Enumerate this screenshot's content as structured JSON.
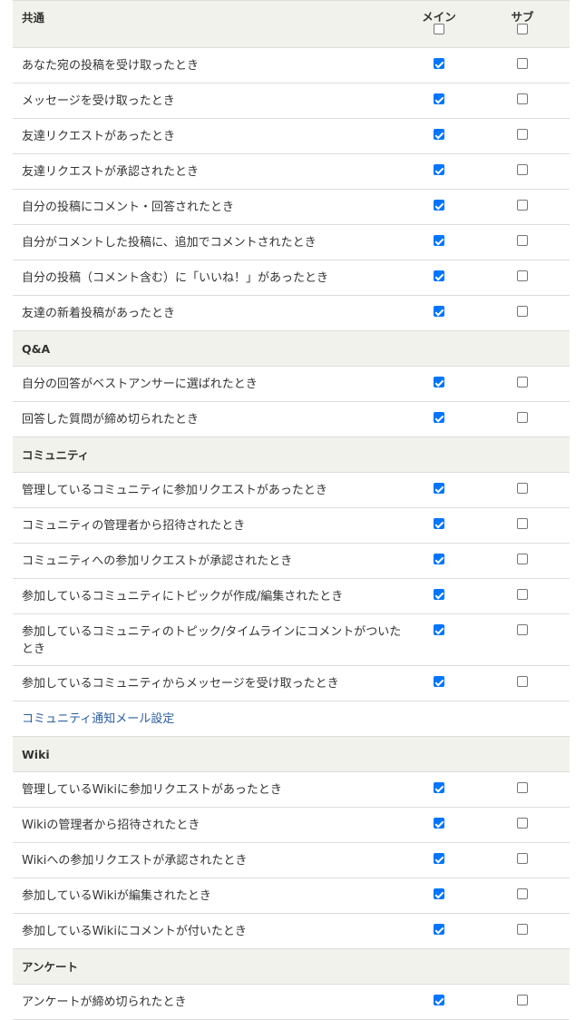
{
  "columns": {
    "main": "メイン",
    "sub": "サブ"
  },
  "header_checks": {
    "main": false,
    "sub": false
  },
  "sections": [
    {
      "title": "共通",
      "items": [
        {
          "label": "あなた宛の投稿を受け取ったとき",
          "main": true,
          "sub": false
        },
        {
          "label": "メッセージを受け取ったとき",
          "main": true,
          "sub": false
        },
        {
          "label": "友達リクエストがあったとき",
          "main": true,
          "sub": false
        },
        {
          "label": "友達リクエストが承認されたとき",
          "main": true,
          "sub": false
        },
        {
          "label": "自分の投稿にコメント・回答されたとき",
          "main": true,
          "sub": false
        },
        {
          "label": "自分がコメントした投稿に、追加でコメントされたとき",
          "main": true,
          "sub": false
        },
        {
          "label": "自分の投稿（コメント含む）に「いいね！」があったとき",
          "main": true,
          "sub": false
        },
        {
          "label": "友達の新着投稿があったとき",
          "main": true,
          "sub": false
        }
      ]
    },
    {
      "title": "Q&A",
      "items": [
        {
          "label": "自分の回答がベストアンサーに選ばれたとき",
          "main": true,
          "sub": false
        },
        {
          "label": "回答した質問が締め切られたとき",
          "main": true,
          "sub": false
        }
      ]
    },
    {
      "title": "コミュニティ",
      "items": [
        {
          "label": "管理しているコミュニティに参加リクエストがあったとき",
          "main": true,
          "sub": false
        },
        {
          "label": "コミュニティの管理者から招待されたとき",
          "main": true,
          "sub": false
        },
        {
          "label": "コミュニティへの参加リクエストが承認されたとき",
          "main": true,
          "sub": false
        },
        {
          "label": "参加しているコミュニティにトピックが作成/編集されたとき",
          "main": true,
          "sub": false
        },
        {
          "label": "参加しているコミュニティのトピック/タイムラインにコメントがついたとき",
          "main": true,
          "sub": false,
          "tall": true
        },
        {
          "label": "参加しているコミュニティからメッセージを受け取ったとき",
          "main": true,
          "sub": false
        }
      ],
      "link": "コミュニティ通知メール設定"
    },
    {
      "title": "Wiki",
      "items": [
        {
          "label": "管理しているWikiに参加リクエストがあったとき",
          "main": true,
          "sub": false
        },
        {
          "label": "Wikiの管理者から招待されたとき",
          "main": true,
          "sub": false
        },
        {
          "label": "Wikiへの参加リクエストが承認されたとき",
          "main": true,
          "sub": false
        },
        {
          "label": "参加しているWikiが編集されたとき",
          "main": true,
          "sub": false
        },
        {
          "label": "参加しているWikiにコメントが付いたとき",
          "main": true,
          "sub": false
        }
      ]
    },
    {
      "title": "アンケート",
      "items": [
        {
          "label": "アンケートが締め切られたとき",
          "main": true,
          "sub": false
        }
      ]
    }
  ]
}
